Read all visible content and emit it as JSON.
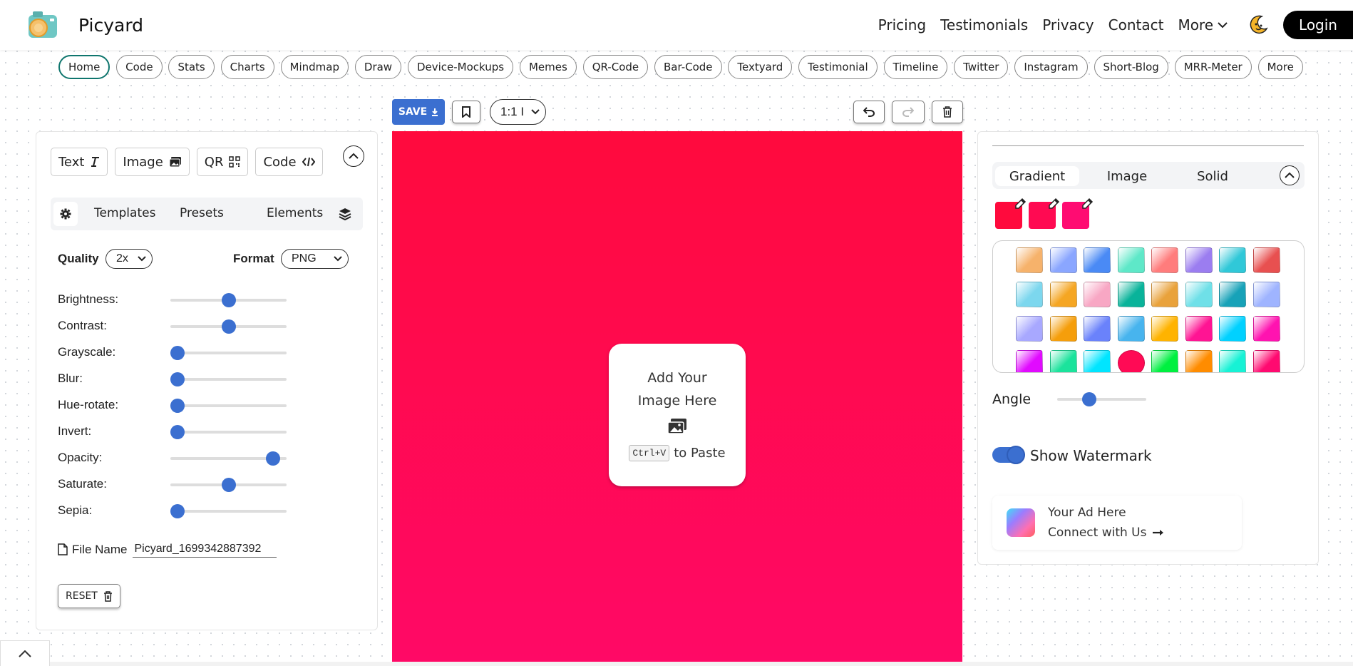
{
  "header": {
    "brand": "Picyard",
    "nav": [
      "Pricing",
      "Testimonials",
      "Privacy",
      "Contact"
    ],
    "more_label": "More",
    "login_label": "Login"
  },
  "tools": {
    "active": "Home",
    "items": [
      "Home",
      "Code",
      "Stats",
      "Charts",
      "Mindmap",
      "Draw",
      "Device-Mockups",
      "Memes",
      "QR-Code",
      "Bar-Code",
      "Textyard",
      "Testimonial",
      "Timeline",
      "Twitter",
      "Instagram",
      "Short-Blog",
      "MRR-Meter",
      "More"
    ]
  },
  "left_panel": {
    "add_buttons": {
      "text": "Text",
      "image": "Image",
      "qr": "QR",
      "code": "Code"
    },
    "tabs": {
      "templates": "Templates",
      "presets": "Presets",
      "elements": "Elements"
    },
    "quality": {
      "label": "Quality",
      "value": "2x"
    },
    "format": {
      "label": "Format",
      "value": "PNG"
    },
    "sliders": [
      {
        "label": "Brightness:",
        "value": 0.5
      },
      {
        "label": "Contrast:",
        "value": 0.5
      },
      {
        "label": "Grayscale:",
        "value": 0
      },
      {
        "label": "Blur:",
        "value": 0
      },
      {
        "label": "Hue-rotate:",
        "value": 0
      },
      {
        "label": "Invert:",
        "value": 0
      },
      {
        "label": "Opacity:",
        "value": 0.94
      },
      {
        "label": "Saturate:",
        "value": 0.5
      },
      {
        "label": "Sepia:",
        "value": 0
      }
    ],
    "file_name": {
      "label": "File Name",
      "value": "Picyard_1699342887392"
    },
    "reset_label": "RESET"
  },
  "canvas_toolbar": {
    "save_label": "SAVE",
    "ratio": "1:1 I"
  },
  "canvas": {
    "line1": "Add Your",
    "line2": "Image Here",
    "shortcut": "Ctrl+V",
    "paste_text": "to Paste",
    "gradient_from": "#ff0a3d",
    "gradient_to": "#ff0966"
  },
  "right_panel": {
    "bg_tabs": [
      "Gradient",
      "Image",
      "Solid"
    ],
    "active_bg_tab": "Gradient",
    "picked_colors": [
      "#ff0a3d",
      "#ff0a52",
      "#ff0c72"
    ],
    "swatches": [
      [
        "#f6b26b",
        "#8aa6ff",
        "#4a8af5",
        "#5ee8c8",
        "#ff7c7c",
        "#9b7df0",
        "#30c8d8",
        "#e85050"
      ],
      [
        "#7cd7ee",
        "#f5a623",
        "#f8a7c4",
        "#09b39a",
        "#e9a23b",
        "#6fe0e8",
        "#17a2b8",
        "#9fb4ff"
      ],
      [
        "#a8a8ff",
        "#f59e0b",
        "#6a82fb",
        "#47b4ee",
        "#ffb300",
        "#ff1493",
        "#00d1ff",
        "#ff13b0"
      ],
      [
        "#e10aff",
        "#1be39c",
        "#00e5ff",
        "#ff0a55",
        "#00f040",
        "#ff8c00",
        "#17f2d5",
        "#ff0a70"
      ]
    ],
    "angle": {
      "label": "Angle",
      "value": 0.33
    },
    "watermark_label": "Show Watermark",
    "watermark_on": true,
    "ad": {
      "line1": "Your Ad Here",
      "line2": "Connect with Us"
    }
  },
  "colors": {
    "accent": "#3b6fd0",
    "active_pill": "#0f766e"
  }
}
